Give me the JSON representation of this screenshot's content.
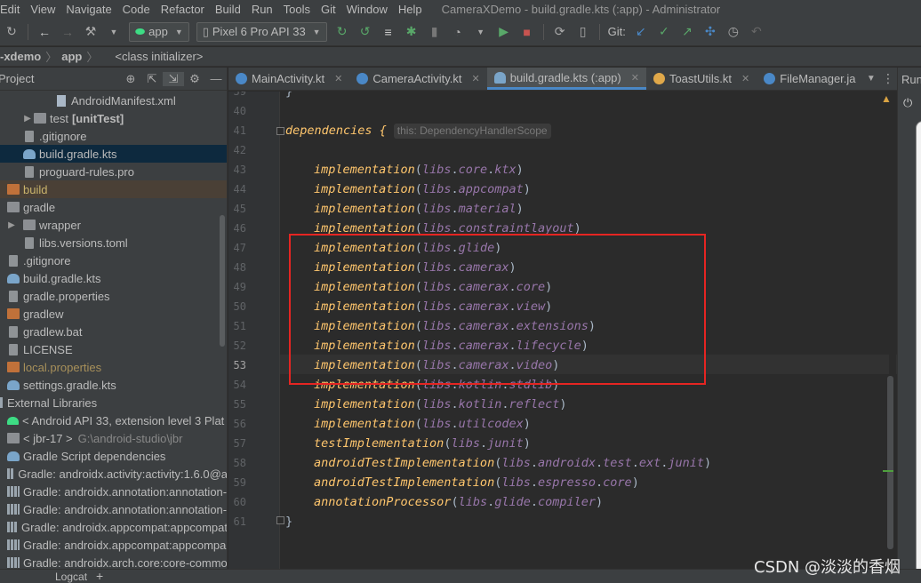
{
  "menu": {
    "items": [
      "Edit",
      "View",
      "Navigate",
      "Code",
      "Refactor",
      "Build",
      "Run",
      "Tools",
      "Git",
      "Window",
      "Help"
    ],
    "first_item": "Edit",
    "window_title": "CameraXDemo - build.gradle.kts (:app) - Administrator"
  },
  "toolbar": {
    "module_select": "app",
    "device_select": "Pixel 6 Pro API 33",
    "git_label": "Git:"
  },
  "breadcrumb": {
    "project": "-xdemo",
    "module": "app",
    "element": "<class initializer>"
  },
  "project_panel": {
    "title": "Project",
    "items": [
      {
        "label": "AndroidManifest.xml",
        "icon": "xml-file-icon"
      },
      {
        "label": "test",
        "suffix": "[unitTest]",
        "icon": "folder-icon"
      },
      {
        "label": ".gitignore",
        "icon": "file-icon"
      },
      {
        "label": "build.gradle.kts",
        "icon": "gradle-icon"
      },
      {
        "label": "proguard-rules.pro",
        "icon": "file-icon"
      },
      {
        "label": "build",
        "icon": "folder-icon"
      },
      {
        "label": "gradle",
        "icon": "folder-icon"
      },
      {
        "label": "wrapper",
        "icon": "folder-icon"
      },
      {
        "label": "libs.versions.toml",
        "icon": "file-icon"
      },
      {
        "label": ".gitignore",
        "icon": "file-icon"
      },
      {
        "label": "build.gradle.kts",
        "icon": "gradle-icon"
      },
      {
        "label": "gradle.properties",
        "icon": "file-icon"
      },
      {
        "label": "gradlew",
        "icon": "file-icon"
      },
      {
        "label": "gradlew.bat",
        "icon": "file-icon"
      },
      {
        "label": "LICENSE",
        "icon": "file-icon"
      },
      {
        "label": "local.properties",
        "icon": "file-icon"
      },
      {
        "label": "settings.gradle.kts",
        "icon": "gradle-icon"
      },
      {
        "label": "External Libraries",
        "icon": "library-icon"
      },
      {
        "label": "< Android API 33, extension level 3 Plat",
        "icon": "android-icon"
      },
      {
        "label": "< jbr-17 >",
        "suffix": "G:\\android-studio\\jbr",
        "icon": "folder-icon"
      },
      {
        "label": "Gradle Script dependencies",
        "icon": "gradle-icon"
      },
      {
        "label": "Gradle: androidx.activity:activity:1.6.0@a",
        "icon": "library-icon"
      },
      {
        "label": "Gradle: androidx.annotation:annotation-",
        "icon": "library-icon"
      },
      {
        "label": "Gradle: androidx.annotation:annotation-",
        "icon": "library-icon"
      },
      {
        "label": "Gradle: androidx.appcompat:appcompat",
        "icon": "library-icon"
      },
      {
        "label": "Gradle: androidx.appcompat:appcompa",
        "icon": "library-icon"
      },
      {
        "label": "Gradle: androidx.arch.core:core-commo",
        "icon": "library-icon"
      }
    ]
  },
  "tabs": [
    {
      "label": "MainActivity.kt",
      "color": "#4a88c7"
    },
    {
      "label": "CameraActivity.kt",
      "color": "#4a88c7"
    },
    {
      "label": "build.gradle.kts (:app)",
      "color": "#7aa5c9",
      "active": true
    },
    {
      "label": "ToastUtils.kt",
      "color": "#e0a84a"
    },
    {
      "label": "FileManager.ja",
      "color": "#4a88c7"
    }
  ],
  "right_strip": {
    "label": "Run"
  },
  "editor": {
    "lines": [
      {
        "num": "39",
        "text": "}"
      },
      {
        "num": "40",
        "text": ""
      },
      {
        "num": "41",
        "text": "dependencies {",
        "hint": "this: DependencyHandlerScope"
      },
      {
        "num": "42",
        "text": ""
      },
      {
        "num": "43",
        "fn": "implementation",
        "path": [
          "core",
          "ktx"
        ]
      },
      {
        "num": "44",
        "fn": "implementation",
        "path": [
          "appcompat"
        ]
      },
      {
        "num": "45",
        "fn": "implementation",
        "path": [
          "material"
        ]
      },
      {
        "num": "46",
        "fn": "implementation",
        "path": [
          "constraintlayout"
        ]
      },
      {
        "num": "47",
        "fn": "implementation",
        "path": [
          "glide"
        ]
      },
      {
        "num": "48",
        "fn": "implementation",
        "path": [
          "camerax"
        ]
      },
      {
        "num": "49",
        "fn": "implementation",
        "path": [
          "camerax",
          "core"
        ]
      },
      {
        "num": "50",
        "fn": "implementation",
        "path": [
          "camerax",
          "view"
        ]
      },
      {
        "num": "51",
        "fn": "implementation",
        "path": [
          "camerax",
          "extensions"
        ]
      },
      {
        "num": "52",
        "fn": "implementation",
        "path": [
          "camerax",
          "lifecycle"
        ]
      },
      {
        "num": "53",
        "fn": "implementation",
        "path": [
          "camerax",
          "video"
        ],
        "current": true
      },
      {
        "num": "54",
        "fn": "implementation",
        "path": [
          "kotlin",
          "stdlib"
        ]
      },
      {
        "num": "55",
        "fn": "implementation",
        "path": [
          "kotlin",
          "reflect"
        ]
      },
      {
        "num": "56",
        "fn": "implementation",
        "path": [
          "utilcodex"
        ]
      },
      {
        "num": "57",
        "fn": "testImplementation",
        "path": [
          "junit"
        ]
      },
      {
        "num": "58",
        "fn": "androidTestImplementation",
        "path": [
          "androidx",
          "test",
          "ext",
          "junit"
        ]
      },
      {
        "num": "59",
        "fn": "androidTestImplementation",
        "path": [
          "espresso",
          "core"
        ]
      },
      {
        "num": "60",
        "fn": "annotationProcessor",
        "path": [
          "glide",
          "compiler"
        ]
      },
      {
        "num": "61",
        "text": "}"
      }
    ],
    "libs_token": "libs"
  },
  "bottom": {
    "logcat": "Logcat"
  },
  "watermark": "CSDN @淡淡的香烟",
  "colors": {
    "accent": "#4a88c7",
    "highlight_box": "#e52522",
    "function": "#ffc66d",
    "property": "#9876aa"
  }
}
